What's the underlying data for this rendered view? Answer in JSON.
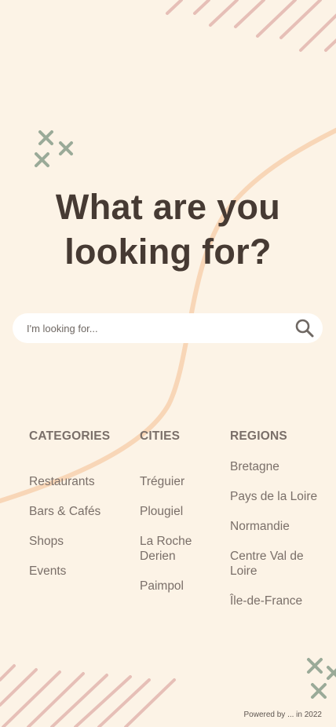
{
  "hero": {
    "title_line1": "What are you",
    "title_line2": "looking for?"
  },
  "search": {
    "placeholder": "I'm looking for...",
    "icon": "search-icon"
  },
  "columns": {
    "categories": {
      "heading": "CATEGORIES",
      "items": [
        "Restaurants",
        "Bars & Cafés",
        "Shops",
        "Events"
      ]
    },
    "cities": {
      "heading": "CITIES",
      "items": [
        "Tréguier",
        "Plougiel",
        "La Roche Derien",
        "Paimpol"
      ]
    },
    "regions": {
      "heading": "REGIONS",
      "items": [
        "Bretagne",
        "Pays de la Loire",
        "Normandie",
        "Centre Val de Loire",
        "Île-de-France"
      ]
    }
  },
  "footer": {
    "text": "Powered by ...  in 2022"
  },
  "colors": {
    "background": "#fcf3e6",
    "stripes": "#e6bfb7",
    "crosses": "#9aaa98",
    "curve": "#f8d6b7",
    "title": "#463a33",
    "text": "#7a6f69"
  }
}
